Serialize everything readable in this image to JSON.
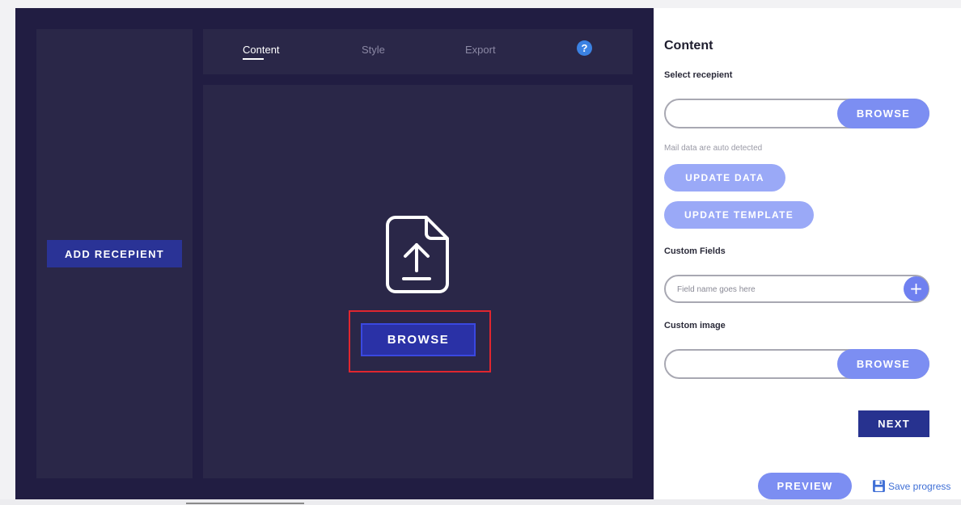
{
  "left_panel": {
    "add_recipient_label": "ADD RECEPIENT"
  },
  "tabs": [
    {
      "label": "Content",
      "active": true
    },
    {
      "label": "Style",
      "active": false
    },
    {
      "label": "Export",
      "active": false
    }
  ],
  "help": {
    "icon": "question-circle-icon",
    "glyph": "?"
  },
  "canvas": {
    "upload_icon": "file-upload-icon",
    "browse_label": "BROWSE"
  },
  "side": {
    "title": "Content",
    "select_recipient_label": "Select recepient",
    "recipient_browse_label": "BROWSE",
    "hint": "Mail data are auto detected",
    "update_data_label": "UPDATE DATA",
    "update_template_label": "UPDATE TEMPLATE",
    "custom_fields_label": "Custom Fields",
    "custom_field_placeholder": "Field name goes here",
    "add_field_glyph": "+",
    "custom_image_label": "Custom image",
    "image_browse_label": "BROWSE",
    "next_label": "NEXT",
    "preview_label": "PREVIEW",
    "save_progress_label": "Save progress"
  },
  "colors": {
    "dark_bg": "#211d42",
    "panel_bg": "#2a2748",
    "primary": "#2a3396",
    "accent_soft": "#7c8ef2",
    "highlight": "#e0262f",
    "link": "#3f6fd6"
  }
}
